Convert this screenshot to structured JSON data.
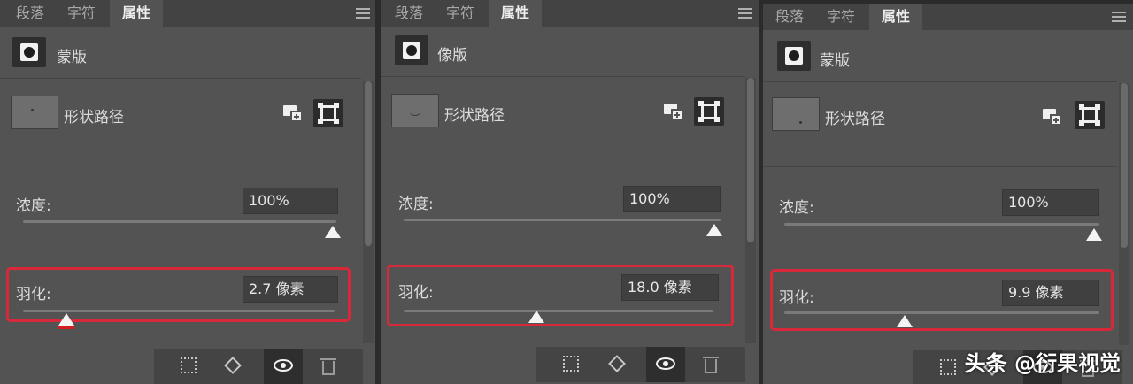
{
  "tabs": [
    "段落",
    "字符",
    "属性"
  ],
  "active_tab": "属性",
  "panels": [
    {
      "title": "蒙版",
      "path_label": "形状路径",
      "density_label": "浓度:",
      "density_value": "100%",
      "density_fraction": 1.0,
      "feather_label": "羽化:",
      "feather_value": "2.7 像素",
      "feather_fraction": 0.13
    },
    {
      "title": "像版",
      "path_label": "形状路径",
      "density_label": "浓度:",
      "density_value": "100%",
      "density_fraction": 1.0,
      "feather_label": "羽化:",
      "feather_value": "18.0 像素",
      "feather_fraction": 0.42
    },
    {
      "title": "蒙版",
      "path_label": "形状路径",
      "density_label": "浓度:",
      "density_value": "100%",
      "density_fraction": 1.0,
      "feather_label": "羽化:",
      "feather_value": "9.9 像素",
      "feather_fraction": 0.39
    }
  ],
  "watermark": "头条 @衍果视觉",
  "colors": {
    "panel_bg": "#535353",
    "highlight": "#d8283a"
  },
  "icons": [
    "menu-icon",
    "mask-icon",
    "add-mask-icon",
    "select-mask-icon",
    "dotted-select-icon",
    "apply-mask-icon",
    "eye-icon",
    "trash-icon"
  ]
}
